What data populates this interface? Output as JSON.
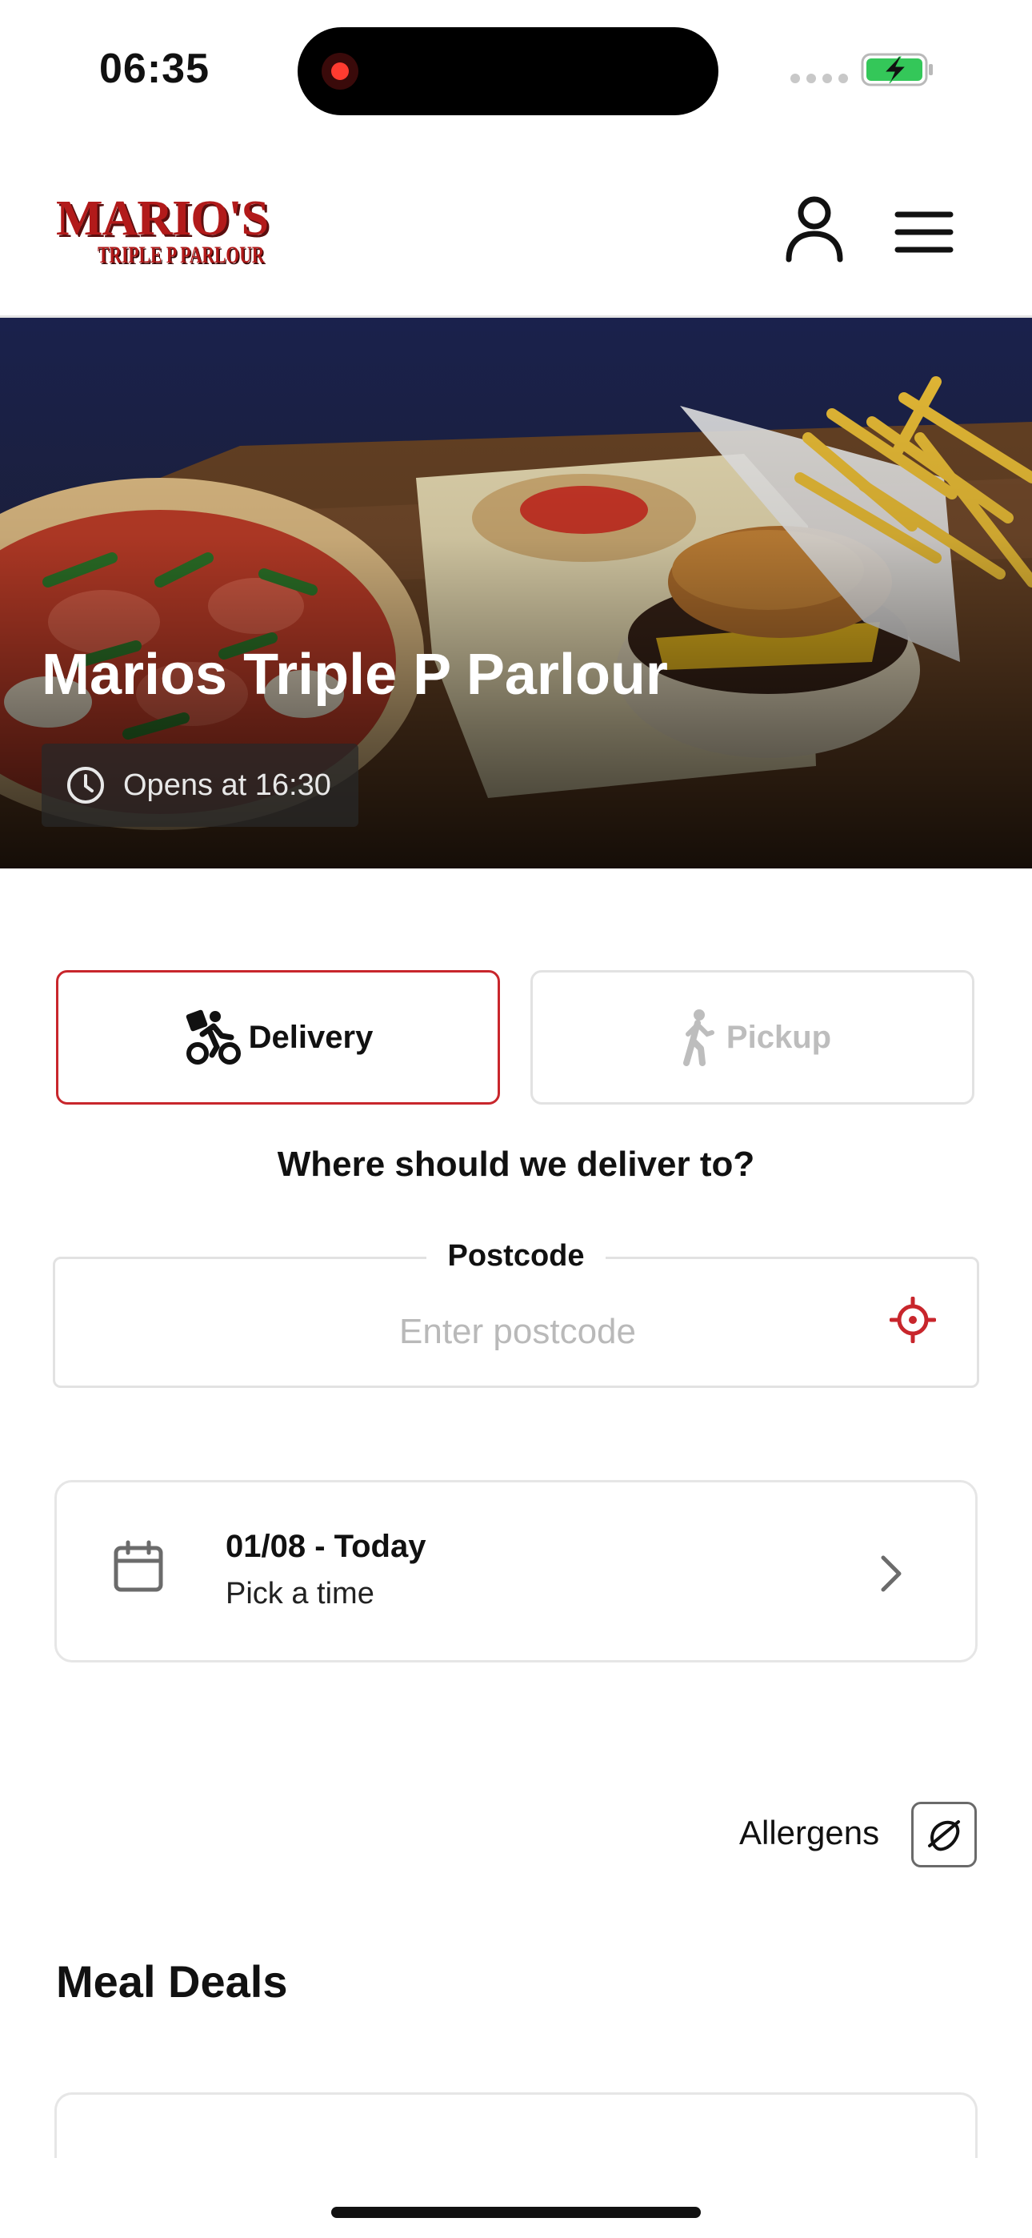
{
  "status_bar": {
    "time": "06:35"
  },
  "header": {
    "logo_main": "MARIO'S",
    "logo_sub": "TRIPLE P PARLOUR"
  },
  "hero": {
    "title": "Marios Triple P Parlour",
    "opens_text": "Opens at 16:30"
  },
  "order_mode": {
    "delivery_label": "Delivery",
    "pickup_label": "Pickup",
    "selected": "Delivery"
  },
  "delivery": {
    "question": "Where should we deliver to?",
    "postcode_label": "Postcode",
    "postcode_placeholder": "Enter postcode",
    "postcode_value": ""
  },
  "time_picker": {
    "date": "01/08 - Today",
    "sub": "Pick a time"
  },
  "allergens": {
    "label": "Allergens"
  },
  "menu": {
    "section_title": "Meal Deals"
  },
  "colors": {
    "accent": "#c8262c",
    "border": "#e2e2e2",
    "placeholder": "#b9b9b9",
    "battery": "#34c759"
  },
  "icons": [
    "record-icon",
    "signal-icon",
    "battery-charging-icon",
    "user-icon",
    "hamburger-menu-icon",
    "clock-icon",
    "delivery-bike-icon",
    "walking-person-icon",
    "crosshair-location-icon",
    "calendar-icon",
    "chevron-right-icon",
    "allergens-icon"
  ]
}
